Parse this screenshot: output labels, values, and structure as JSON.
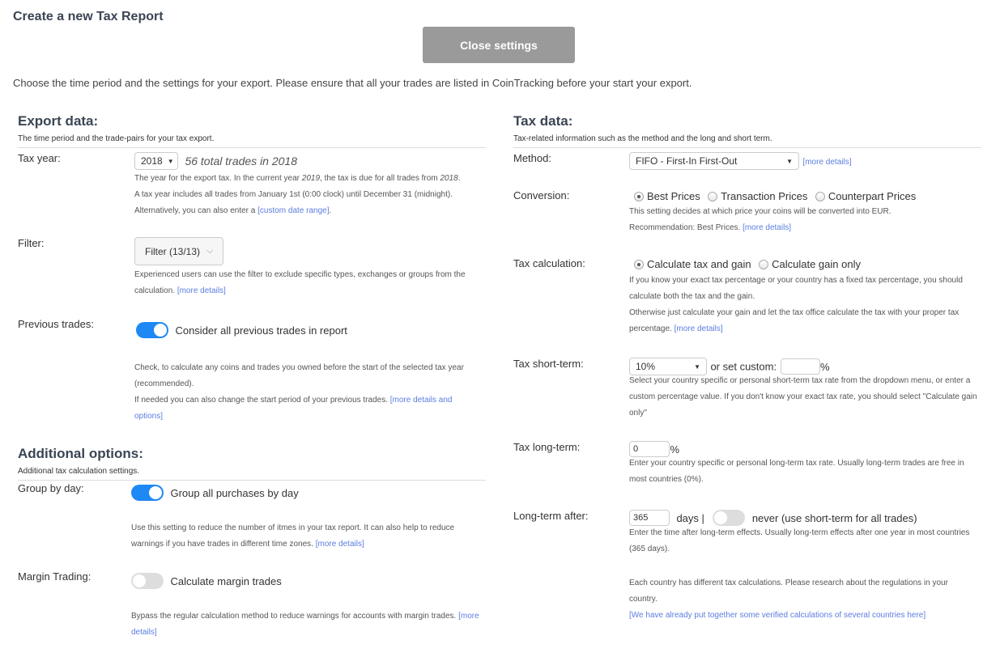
{
  "header": {
    "title": "Create a new Tax Report",
    "close_button": "Close settings",
    "intro": "Choose the time period and the settings for your export. Please ensure that all your trades are listed in CoinTracking before your start your export."
  },
  "export": {
    "title": "Export data:",
    "subtitle": "The time period and the trade-pairs for your tax export.",
    "tax_year": {
      "label": "Tax year:",
      "value": "2018",
      "note": "56 total trades in 2018",
      "help1_a": "The year for the export tax. In the current year ",
      "help1_year": "2019",
      "help1_b": ", the tax is due for all trades from ",
      "help1_year2": "2018",
      "help1_c": ".",
      "help2": "A tax year includes all trades from January 1st (0:00 clock) until December 31 (midnight).",
      "help3": "Alternatively, you can also enter a ",
      "help3_link": "[custom date range]",
      "help3_end": "."
    },
    "filter": {
      "label": "Filter:",
      "button": "Filter (13/13)",
      "help": "Experienced users can use the filter to exclude specific types, exchanges or groups from the calculation. ",
      "link": "[more details]"
    },
    "previous": {
      "label": "Previous trades:",
      "toggle_on": true,
      "toggle_label": "Consider all previous trades in report",
      "help1": "Check, to calculate any coins and trades you owned before the start of the selected tax year (recommended).",
      "help2": "If needed you can also change the start period of your previous trades. ",
      "link": "[more details and options]"
    }
  },
  "additional": {
    "title": "Additional options:",
    "subtitle": "Additional tax calculation settings.",
    "group": {
      "label": "Group by day:",
      "toggle_on": true,
      "toggle_label": "Group all purchases by day",
      "help": "Use this setting to reduce the number of itmes in your tax report. It can also help to reduce warnings if you have trades in different time zones. ",
      "link": "[more details]"
    },
    "margin": {
      "label": "Margin Trading:",
      "toggle_on": false,
      "toggle_label": "Calculate margin trades",
      "help": "Bypass the regular calculation method to reduce warnings for accounts with margin trades. ",
      "link": "[more details]"
    }
  },
  "tax": {
    "title": "Tax data:",
    "subtitle": "Tax-related information such as the method and the long and short term.",
    "method": {
      "label": "Method:",
      "value": "FIFO - First-In First-Out",
      "link": "[more details]"
    },
    "conversion": {
      "label": "Conversion:",
      "options": [
        "Best Prices",
        "Transaction Prices",
        "Counterpart Prices"
      ],
      "selected": "Best Prices",
      "help1": "This setting decides at which price your coins will be converted into EUR.",
      "help2": "Recommendation: Best Prices. ",
      "link": "[more details]"
    },
    "calculation": {
      "label": "Tax calculation:",
      "options": [
        "Calculate tax and gain",
        "Calculate gain only"
      ],
      "selected": "Calculate tax and gain",
      "help1": "If you know your exact tax percentage or your country has a fixed tax percentage, you should calculate both the tax and the gain.",
      "help2": "Otherwise just calculate your gain and let the tax office calculate the tax with your proper tax percentage. ",
      "link": "[more details]"
    },
    "short_term": {
      "label": "Tax short-term:",
      "value": "10%",
      "custom_label": "or set custom:",
      "custom_value": "",
      "percent": "%",
      "help": "Select your country specific or personal short-term tax rate from the dropdown menu, or enter a custom percentage value. If you don't know your exact tax rate, you should select \"Calculate gain only\""
    },
    "long_term": {
      "label": "Tax long-term:",
      "value": "0",
      "percent": "%",
      "help": "Enter your country specific or personal long-term tax rate. Usually long-term trades are free in most countries (0%)."
    },
    "long_after": {
      "label": "Long-term after:",
      "value": "365",
      "days_label": "days |",
      "toggle_on": false,
      "toggle_label": "never (use short-term for all trades)",
      "help": "Enter the time after long-term effects. Usually long-term effects after one year in most countries (365 days).",
      "note": "Each country has different tax calculations. Please research about the regulations in your country.",
      "link": "[We have already put together some verified calculations of several countries here]"
    }
  }
}
